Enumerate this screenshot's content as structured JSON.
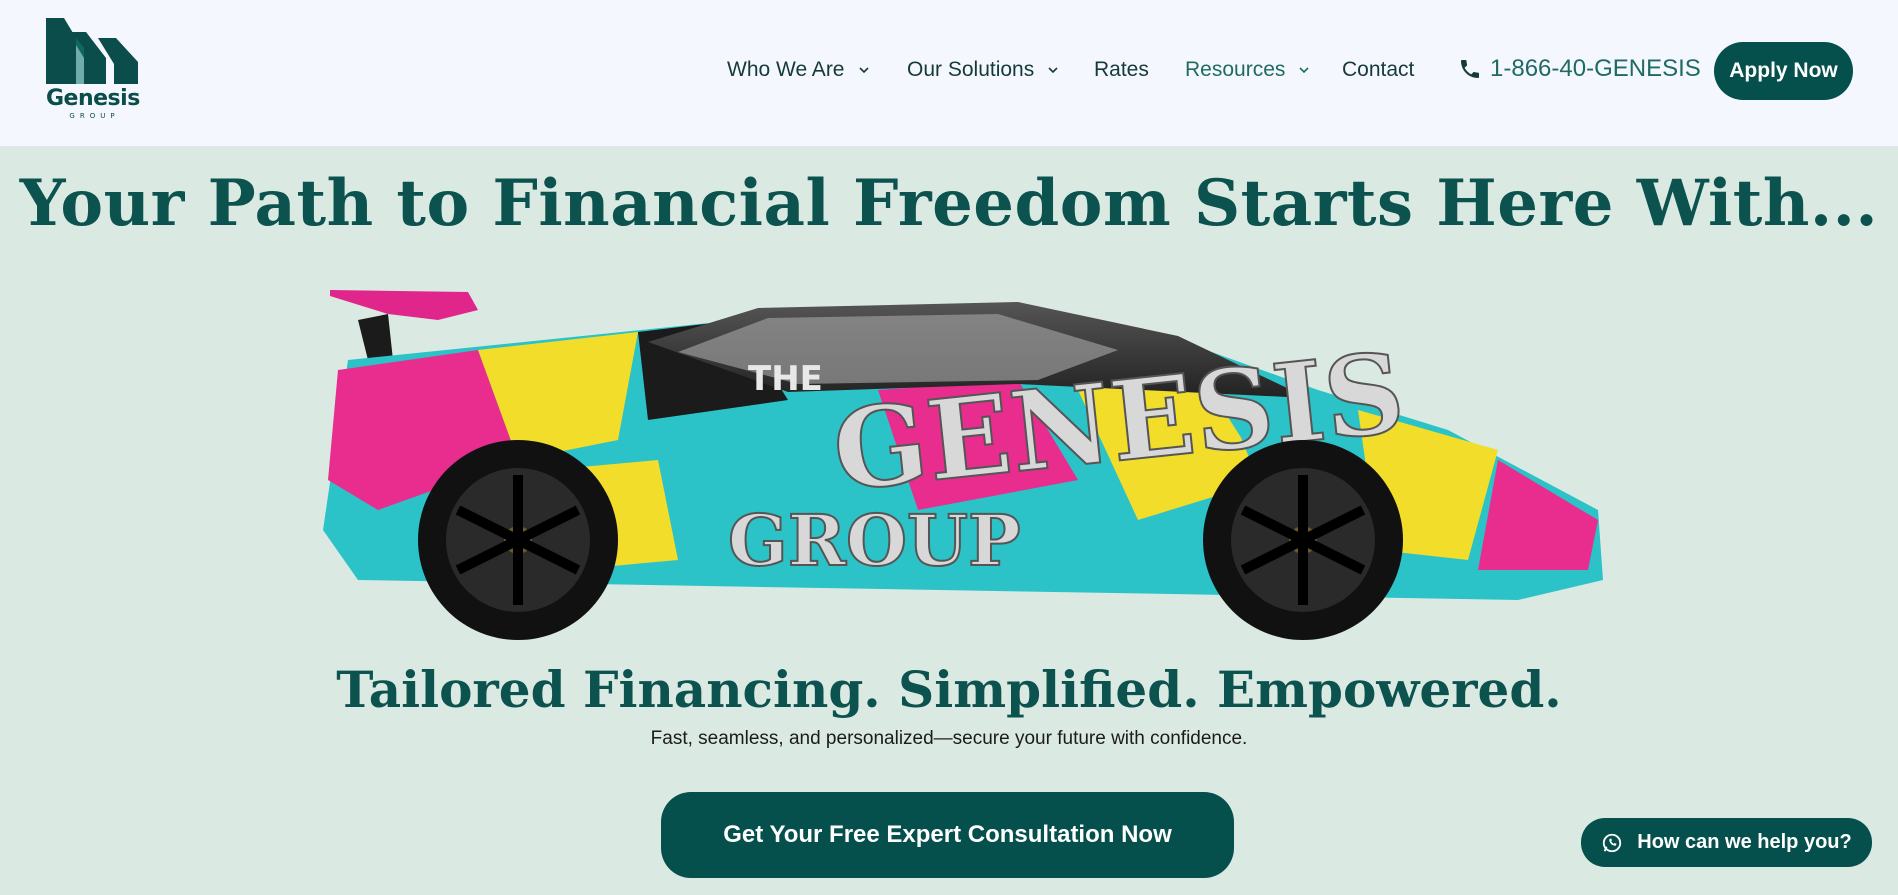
{
  "brand": {
    "name": "Genesis",
    "sub": "GROUP",
    "color": "#0a4d4b"
  },
  "nav": {
    "items": [
      {
        "label": "Who We Are",
        "dropdown": true
      },
      {
        "label": "Our Solutions",
        "dropdown": true
      },
      {
        "label": "Rates",
        "dropdown": false
      },
      {
        "label": "Resources",
        "dropdown": true
      },
      {
        "label": "Contact",
        "dropdown": false
      }
    ],
    "phone": "1-866-40-GENESIS",
    "phone_icon": "phone-icon",
    "apply_label": "Apply Now"
  },
  "hero": {
    "title": "Your Path to Financial Freedom Starts Here With...",
    "image_icon": "graffiti-sports-car",
    "tagline": "Tailored Financing. Simplified. Empowered.",
    "subtext": "Fast, seamless, and personalized—secure your future with confidence.",
    "cta_label": "Get Your Free Expert Consultation Now"
  },
  "chat": {
    "label": "How can we help you?",
    "icon": "whatsapp-icon"
  },
  "colors": {
    "primary": "#05504c",
    "header_bg": "#f5f7fe",
    "page_bg": "#dbe9e3",
    "heading": "#0c524e",
    "accent_link": "#1f6b63"
  }
}
